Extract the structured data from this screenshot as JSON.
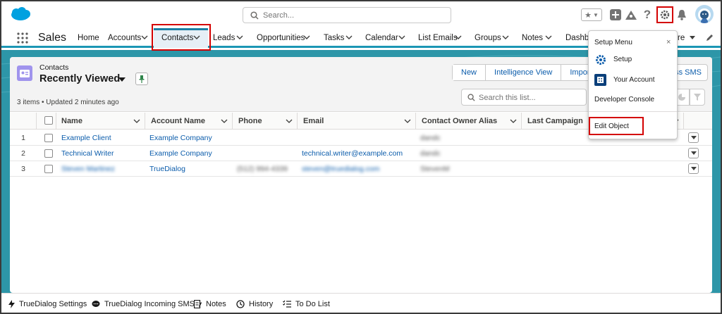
{
  "header": {
    "search_placeholder": "Search...",
    "help_glyph": "?"
  },
  "nav": {
    "app_name": "Sales",
    "items": [
      {
        "label": "Home"
      },
      {
        "label": "Accounts"
      },
      {
        "label": "Contacts",
        "active": true
      },
      {
        "label": "Leads"
      },
      {
        "label": "Opportunities"
      },
      {
        "label": "Tasks"
      },
      {
        "label": "Calendar"
      },
      {
        "label": "List Emails"
      },
      {
        "label": "Groups"
      },
      {
        "label": "Notes"
      },
      {
        "label": "Dashbo"
      },
      {
        "label": "re"
      }
    ]
  },
  "list": {
    "object_label": "Contacts",
    "title": "Recently Viewed",
    "subinfo": "3 items • Updated 2 minutes ago",
    "buttons": [
      "New",
      "Intelligence View",
      "Import"
    ],
    "sms_button": "ss SMS",
    "search_placeholder": "Search this list...",
    "columns": [
      "Name",
      "Account Name",
      "Phone",
      "Email",
      "Contact Owner Alias",
      "Last Campaign"
    ],
    "rows": [
      {
        "num": "1",
        "name": "Example Client",
        "account": "Example Company",
        "phone": "",
        "email": "",
        "owner": "dandc"
      },
      {
        "num": "2",
        "name": "Technical Writer",
        "account": "Example Company",
        "phone": "",
        "email": "technical.writer@example.com",
        "owner": "dandc"
      },
      {
        "num": "3",
        "name": "Steven Martinez",
        "account": "TrueDialog",
        "phone": "(512) 994-4339",
        "email": "steven@truedialog.com",
        "owner": "StevenM"
      }
    ]
  },
  "setup_menu": {
    "title": "Setup Menu",
    "close_glyph": "×",
    "items": [
      "Setup",
      "Your Account",
      "Developer Console",
      "Edit Object"
    ]
  },
  "utility_bar": [
    "TrueDialog Settings",
    "TrueDialog Incoming SMS",
    "Notes",
    "History",
    "To Do List"
  ],
  "colors": {
    "brand": "#1b96b4",
    "link": "#0b5cab",
    "highlight": "#d40000",
    "object_icon": "#a094ed"
  }
}
